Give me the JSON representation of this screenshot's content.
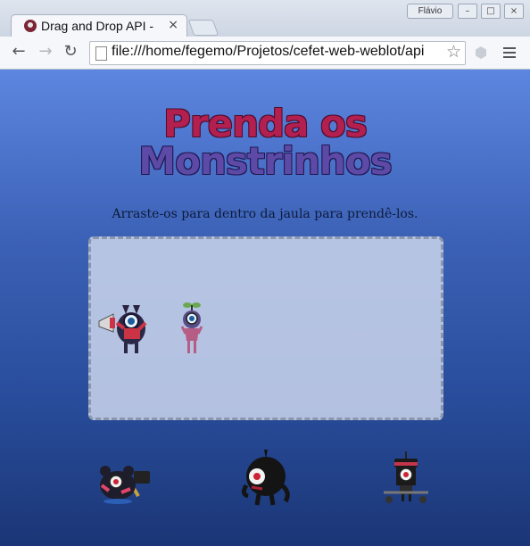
{
  "browser": {
    "tab_title": "Drag and Drop API -",
    "tab_close": "×",
    "user_badge": "Flávio",
    "window_buttons": [
      "–",
      "□",
      "×"
    ],
    "url": "file:///home/fegemo/Projetos/cefet-web-weblot/api",
    "icons": {
      "back": "arrow-left-icon",
      "forward": "arrow-right-icon",
      "reload": "reload-icon",
      "star": "star-icon",
      "extension": "extension-icon",
      "menu": "hamburger-menu-icon"
    }
  },
  "page": {
    "title_line1": "Prenda os",
    "title_line2": "Monstrinhos",
    "subtitle": "Arraste-os para dentro da jaula para prendê-los.",
    "colors": {
      "background_top": "#5d86e0",
      "background_bottom": "#1b3676",
      "title_top": "#b31f4e",
      "title_bottom": "#5d4aa6"
    }
  },
  "cage": {
    "monsters": [
      "monster-megaphone",
      "monster-antenna"
    ]
  },
  "free_monsters": [
    "monster-hammer",
    "monster-black-horned",
    "monster-wheeled"
  ]
}
